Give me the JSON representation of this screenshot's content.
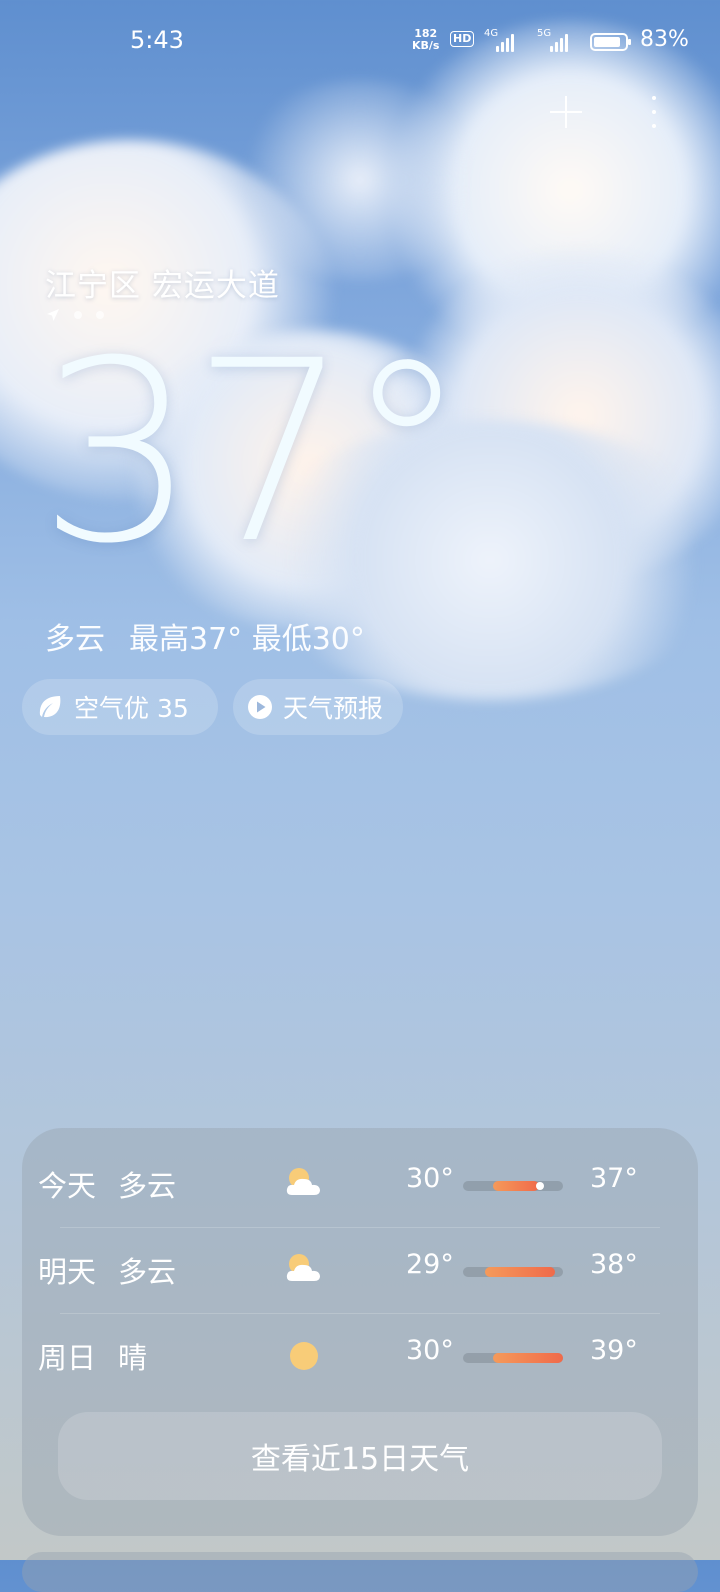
{
  "status_bar": {
    "time": "5:43",
    "net_speed_value": "182",
    "net_speed_unit": "KB/s",
    "hd_label": "HD",
    "sim1_type": "4G",
    "sim2_type": "5G",
    "battery_percent": "83%",
    "battery_level": 0.83
  },
  "header": {
    "location": "江宁区 宏运大道"
  },
  "current": {
    "temperature": "37°",
    "condition": "多云",
    "high_low": "最高37° 最低30°"
  },
  "chips": {
    "air_quality": "空气优 35",
    "forecast_video": "天气预报"
  },
  "forecast": {
    "rows": [
      {
        "day": "今天",
        "condition": "多云",
        "icon": "partly-cloudy-icon",
        "low": "30°",
        "high": "37°"
      },
      {
        "day": "明天",
        "condition": "多云",
        "icon": "partly-cloudy-icon",
        "low": "29°",
        "high": "38°"
      },
      {
        "day": "周日",
        "condition": "晴",
        "icon": "sun-icon",
        "low": "30°",
        "high": "39°"
      }
    ],
    "view_15_days": "查看近15日天气"
  },
  "colors": {
    "range_start": "#f59a5a",
    "range_end": "#f06a4a",
    "sun": "#f8cc78"
  }
}
